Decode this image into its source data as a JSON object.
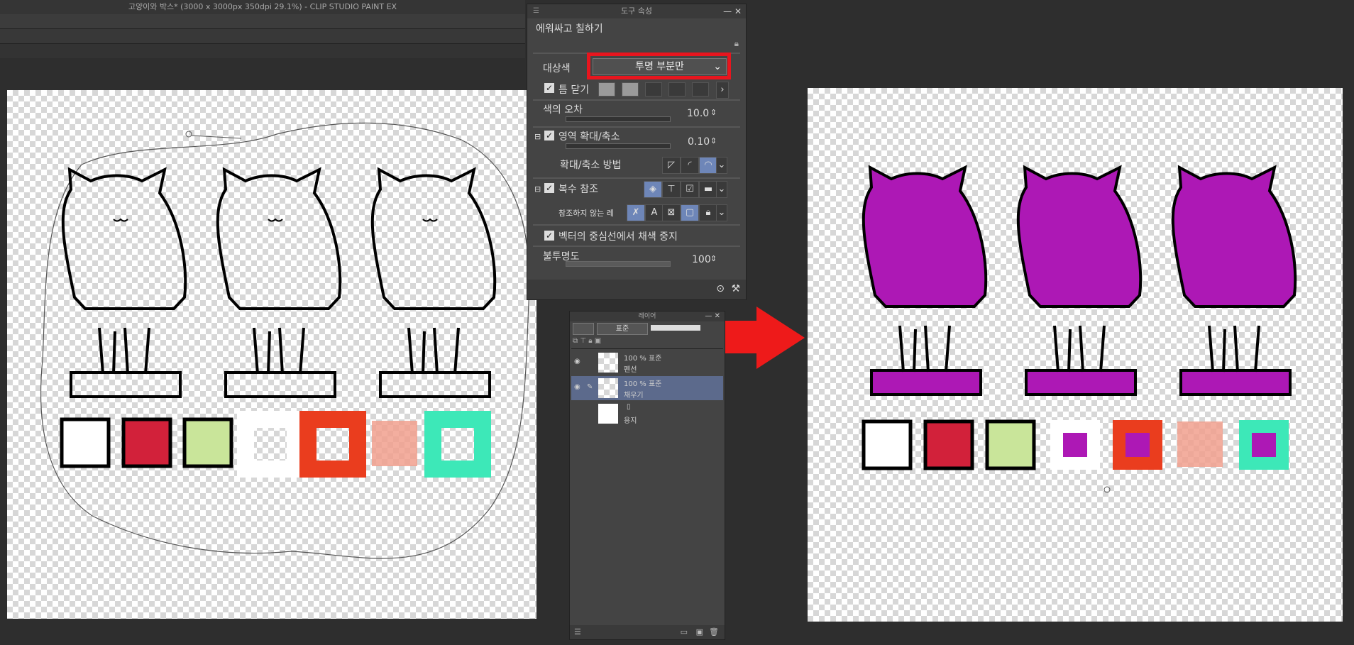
{
  "window": {
    "title": "고양이와 박스* (3000 x 3000px 350dpi 29.1%)  - CLIP STUDIO PAINT EX"
  },
  "tool_panel": {
    "title": "도구 속성",
    "tool_name": "에워싸고 칠하기",
    "target_color": {
      "label": "대상색",
      "value": "투명 부분만"
    },
    "close_gap": {
      "label": "틈 닫기",
      "checked": true
    },
    "color_tolerance": {
      "label": "색의 오차",
      "value": "10.0"
    },
    "area_scaling": {
      "label": "영역 확대/축소",
      "value": "0.10",
      "checked": true
    },
    "scaling_method": {
      "label": "확대/축소 방법"
    },
    "multi_reference": {
      "label": "복수 참조",
      "checked": true
    },
    "exclude_reference": {
      "label": "참조하지 않는 레"
    },
    "stop_at_vector": {
      "label": "벡터의 중심선에서 채색 중지",
      "checked": true
    },
    "opacity": {
      "label": "불투명도",
      "value": "100"
    }
  },
  "layer_panel": {
    "title": "레이어",
    "blend_mode": "표준",
    "layers": [
      {
        "opacity": "100 % 표준",
        "name": "펜선"
      },
      {
        "opacity": "100 % 표준",
        "name": "채우기"
      },
      {
        "opacity": "",
        "name": "용지"
      }
    ]
  },
  "colors": {
    "fill_purple": "#ad18b5",
    "highlight_red": "#e8151e",
    "swatches": [
      "#ffffff",
      "#d2213a",
      "#c9e59a",
      "#ffffff",
      "#ea3d1e",
      "#f1a08e",
      "#3de8b8"
    ]
  },
  "icons": [
    "grip-icon",
    "minimize-icon",
    "close-icon",
    "lock-icon",
    "check-icon",
    "chevron-down-icon",
    "chevron-right-icon",
    "eye-icon",
    "pen-icon",
    "tool-settings-icon",
    "wrench-icon"
  ]
}
